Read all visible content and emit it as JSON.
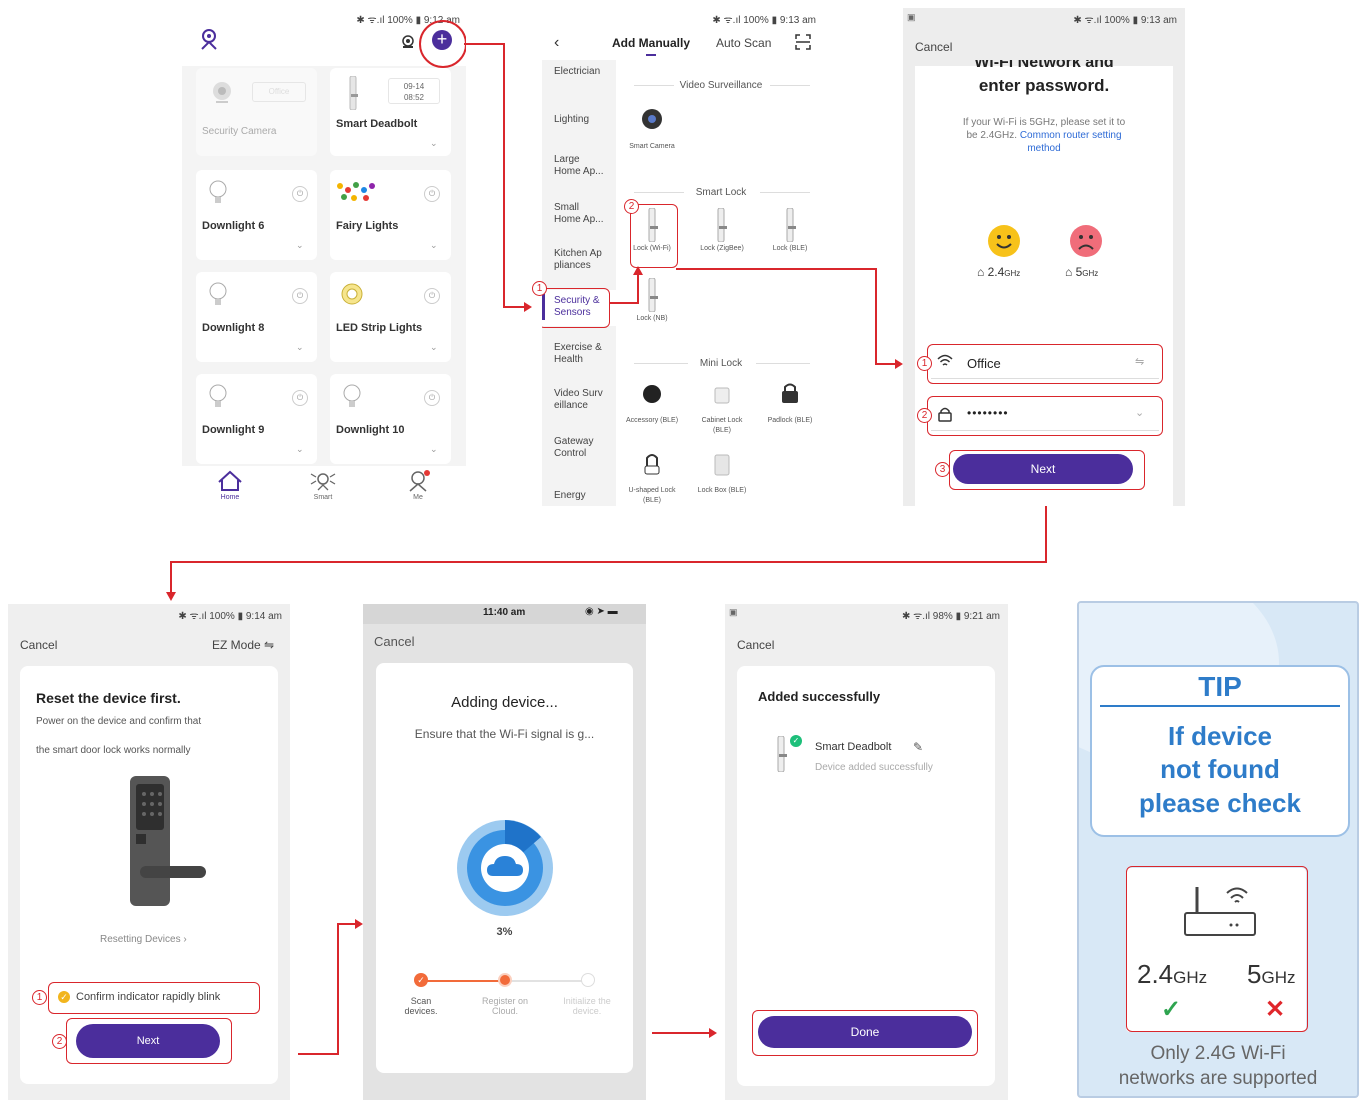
{
  "screen1": {
    "status": "✱ ᯤ.ıl 100% ▮ 9:12 am",
    "devices": [
      {
        "name": "Security Camera",
        "tag": "Office",
        "disabled": true
      },
      {
        "name": "Smart Deadbolt",
        "date": "09-14",
        "time": "08:52"
      },
      {
        "name": "Downlight 6"
      },
      {
        "name": "Fairy Lights"
      },
      {
        "name": "Downlight 8"
      },
      {
        "name": "LED Strip Lights"
      },
      {
        "name": "Downlight 9"
      },
      {
        "name": "Downlight 10"
      }
    ],
    "tabs": [
      "Home",
      "Smart",
      "Me"
    ]
  },
  "screen2": {
    "status": "✱ ᯤ.ıl 100% ▮ 9:13 am",
    "tab_manual": "Add Manually",
    "tab_scan": "Auto Scan",
    "categories": [
      "Electrician",
      "Lighting",
      "Large Home Ap...",
      "Small Home Ap...",
      "Kitchen Ap pliances",
      "Security & Sensors",
      "Exercise & Health",
      "Video Surv eillance",
      "Gateway Control",
      "Energy"
    ],
    "sections": {
      "video": "Video Surveillance",
      "smartlock": "Smart Lock",
      "minilock": "Mini Lock"
    },
    "products": {
      "camera": "Smart Camera",
      "lock_wifi": "Lock (Wi-Fi)",
      "lock_zigbee": "Lock (ZigBee)",
      "lock_ble": "Lock (BLE)",
      "lock_nb": "Lock (NB)",
      "accessory": "Accessory (BLE)",
      "cabinet": "Cabinet Lock (BLE)",
      "padlock": "Padlock (BLE)",
      "ushaped": "U-shaped Lock (BLE)",
      "lockbox": "Lock Box (BLE)"
    }
  },
  "screen3": {
    "status": "✱ ᯤ.ıl 100% ▮ 9:13 am",
    "cancel": "Cancel",
    "heading_partial": "Wi-Fi Network and",
    "heading": "enter password.",
    "note": "If your Wi-Fi is 5GHz, please set it to be 2.4GHz.",
    "link": "Common router setting method",
    "band_24": "2.4",
    "band_24_unit": "GHz",
    "band_5": "5",
    "band_5_unit": "GHz",
    "ssid": "Office",
    "password": "••••••••",
    "next": "Next"
  },
  "screen4": {
    "status": "✱ ᯤ.ıl 100% ▮ 9:14 am",
    "cancel": "Cancel",
    "mode": "EZ Mode ⇋",
    "title": "Reset the device first.",
    "line1": "Power on the device and confirm that",
    "line2": "the smart door lock works normally",
    "resetting": "Resetting Devices ›",
    "confirm": "Confirm indicator rapidly blink",
    "next": "Next"
  },
  "screen5": {
    "status": "11:40 am",
    "cancel": "Cancel",
    "title": "Adding device...",
    "subtitle": "Ensure that the Wi-Fi signal is g...",
    "percent": "3%",
    "progress": 0.03,
    "steps": [
      "Scan devices.",
      "Register on Cloud.",
      "Initialize the device."
    ]
  },
  "screen6": {
    "status": "✱ ᯤ.ıl 98% ▮ 9:21 am",
    "cancel": "Cancel",
    "title": "Added successfully",
    "device": "Smart Deadbolt",
    "device_sub": "Device added successfully",
    "done": "Done"
  },
  "tip": {
    "title": "TIP",
    "lines": [
      "If device",
      "not found",
      "please check"
    ],
    "band1": "2.4",
    "band1_unit": "GHz",
    "band2": "5",
    "band2_unit": "GHz",
    "footer1": "Only 2.4G Wi-Fi",
    "footer2": "networks are supported",
    "colors": {
      "accent": "#2e7cc9",
      "bg": "#d8e8f6",
      "ok": "#2ea44f",
      "bad": "#e0262b"
    }
  },
  "markers": {
    "n1": "1",
    "n2": "2",
    "n3": "3"
  }
}
